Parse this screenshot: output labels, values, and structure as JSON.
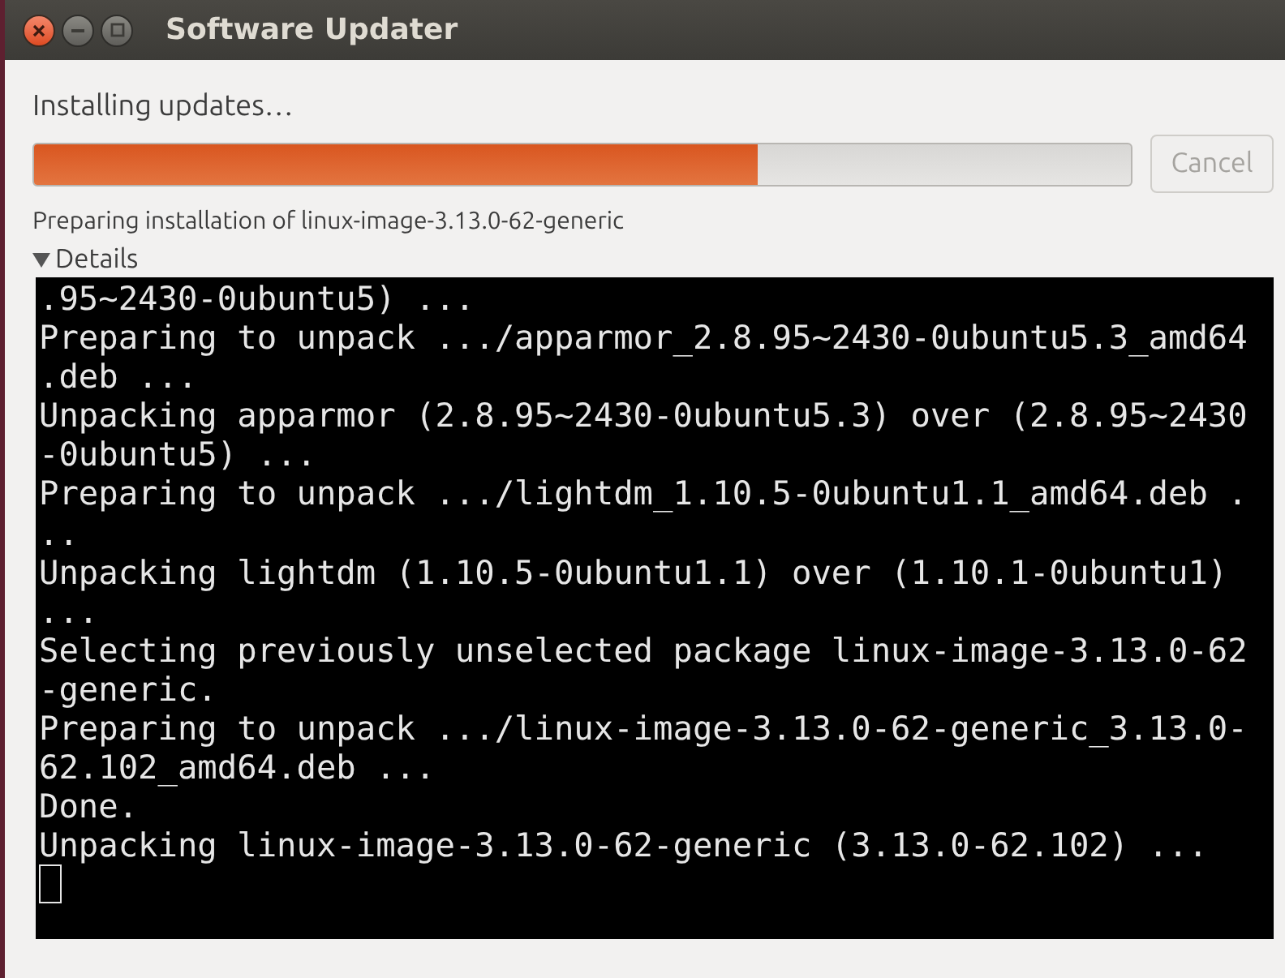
{
  "window": {
    "title": "Software Updater"
  },
  "status": "Installing updates…",
  "progress": {
    "level": 0.66
  },
  "cancel_button": {
    "label": "Cancel",
    "disabled": true
  },
  "step": "Preparing installation of linux-image-3.13.0-62-generic",
  "details": {
    "label": "Details",
    "expanded": true,
    "terminal_lines": [
      ".95~2430-0ubuntu5) ...",
      "Preparing to unpack .../apparmor_2.8.95~2430-0ubuntu5.3_amd64",
      ".deb ...",
      "Unpacking apparmor (2.8.95~2430-0ubuntu5.3) over (2.8.95~2430",
      "-0ubuntu5) ...",
      "Preparing to unpack .../lightdm_1.10.5-0ubuntu1.1_amd64.deb .",
      "..",
      "Unpacking lightdm (1.10.5-0ubuntu1.1) over (1.10.1-0ubuntu1)",
      "...",
      "Selecting previously unselected package linux-image-3.13.0-62",
      "-generic.",
      "Preparing to unpack .../linux-image-3.13.0-62-generic_3.13.0-",
      "62.102_amd64.deb ...",
      "Done.",
      "Unpacking linux-image-3.13.0-62-generic (3.13.0-62.102) ..."
    ]
  }
}
